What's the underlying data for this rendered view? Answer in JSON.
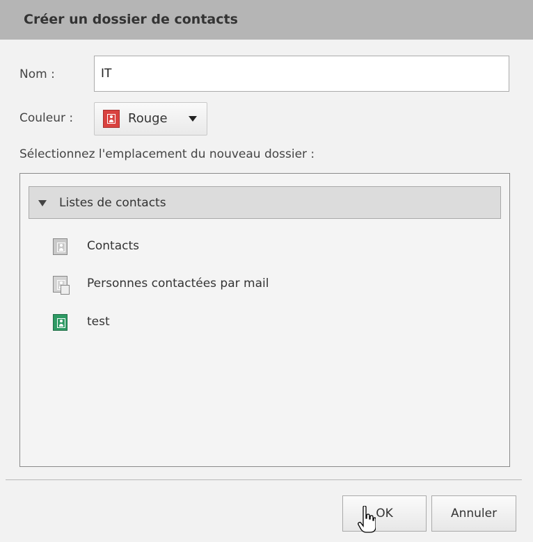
{
  "dialog": {
    "title": "Créer un dossier de contacts"
  },
  "form": {
    "name_label": "Nom :",
    "name_value": "IT",
    "color_label": "Couleur :",
    "color_value": "Rouge",
    "color_hex": "#d9423f",
    "location_label": "Sélectionnez l'emplacement du nouveau dossier :"
  },
  "tree": {
    "root_label": "Listes de contacts",
    "root_expanded": true,
    "items": [
      {
        "label": "Contacts",
        "icon": "contact-folder-icon",
        "color": "#c9c9c9"
      },
      {
        "label": "Personnes contactées par mail",
        "icon": "emailed-contacts-icon",
        "color": "#d4d4d4"
      },
      {
        "label": "test",
        "icon": "contact-folder-icon",
        "color": "#2e9a64"
      }
    ]
  },
  "buttons": {
    "ok_label": "OK",
    "cancel_label": "Annuler"
  }
}
